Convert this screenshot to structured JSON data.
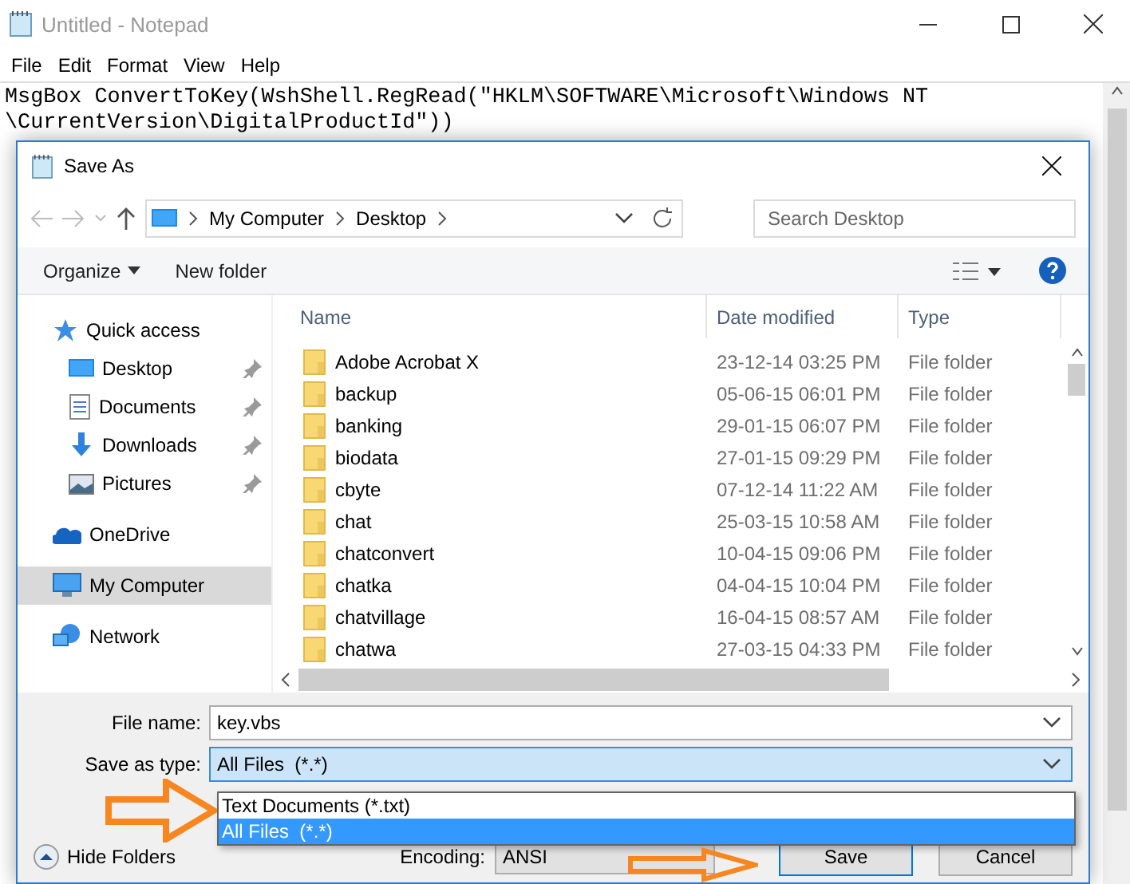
{
  "notepad": {
    "title": "Untitled - Notepad",
    "menu": [
      "File",
      "Edit",
      "Format",
      "View",
      "Help"
    ],
    "lines": [
      "MsgBox ConvertToKey(WshShell.RegRead(\"HKLM\\SOFTWARE\\Microsoft\\Windows NT",
      "\\CurrentVersion\\DigitalProductId\"))"
    ]
  },
  "dialog": {
    "title": "Save As",
    "path": [
      "My Computer",
      "Desktop"
    ],
    "search": {
      "placeholder": "Search Desktop"
    },
    "toolbar": {
      "organize": "Organize",
      "new_folder": "New folder"
    },
    "nav": [
      {
        "label": "Quick access",
        "kind": "star",
        "selected": false,
        "children": [
          {
            "label": "Desktop",
            "kind": "desktop",
            "pinned": true,
            "selected": false
          },
          {
            "label": "Documents",
            "kind": "document",
            "pinned": true,
            "selected": false
          },
          {
            "label": "Downloads",
            "kind": "download",
            "pinned": true,
            "selected": false
          },
          {
            "label": "Pictures",
            "kind": "pictures",
            "pinned": true,
            "selected": false
          }
        ]
      },
      {
        "label": "OneDrive",
        "kind": "cloud",
        "selected": false
      },
      {
        "label": "My Computer",
        "kind": "computer",
        "selected": true
      },
      {
        "label": "Network",
        "kind": "network",
        "selected": false
      }
    ],
    "columns": [
      "Name",
      "Date modified",
      "Type"
    ],
    "files": [
      {
        "name": "Adobe Acrobat X",
        "date": "23-12-14 03:25 PM",
        "type": "File folder"
      },
      {
        "name": "backup",
        "date": "05-06-15 06:01 PM",
        "type": "File folder"
      },
      {
        "name": "banking",
        "date": "29-01-15 06:07 PM",
        "type": "File folder"
      },
      {
        "name": "biodata",
        "date": "27-01-15 09:29 PM",
        "type": "File folder"
      },
      {
        "name": "cbyte",
        "date": "07-12-14 11:22 AM",
        "type": "File folder"
      },
      {
        "name": "chat",
        "date": "25-03-15 10:58 AM",
        "type": "File folder"
      },
      {
        "name": "chatconvert",
        "date": "10-04-15 09:06 PM",
        "type": "File folder"
      },
      {
        "name": "chatka",
        "date": "04-04-15 10:04 PM",
        "type": "File folder"
      },
      {
        "name": "chatvillage",
        "date": "16-04-15 08:57 AM",
        "type": "File folder"
      },
      {
        "name": "chatwa",
        "date": "27-03-15 04:33 PM",
        "type": "File folder"
      }
    ],
    "file_name": {
      "label": "File name:",
      "value": "key.vbs"
    },
    "save_type": {
      "label": "Save as type:",
      "value": "All Files  (*.*)",
      "options": [
        {
          "label": "Text Documents (*.txt)",
          "selected": false
        },
        {
          "label": "All Files  (*.*)",
          "selected": true
        }
      ]
    },
    "hide_folders": "Hide Folders",
    "encoding": {
      "label": "Encoding:",
      "value": "ANSI"
    },
    "buttons": [
      "Save",
      "Cancel"
    ]
  }
}
